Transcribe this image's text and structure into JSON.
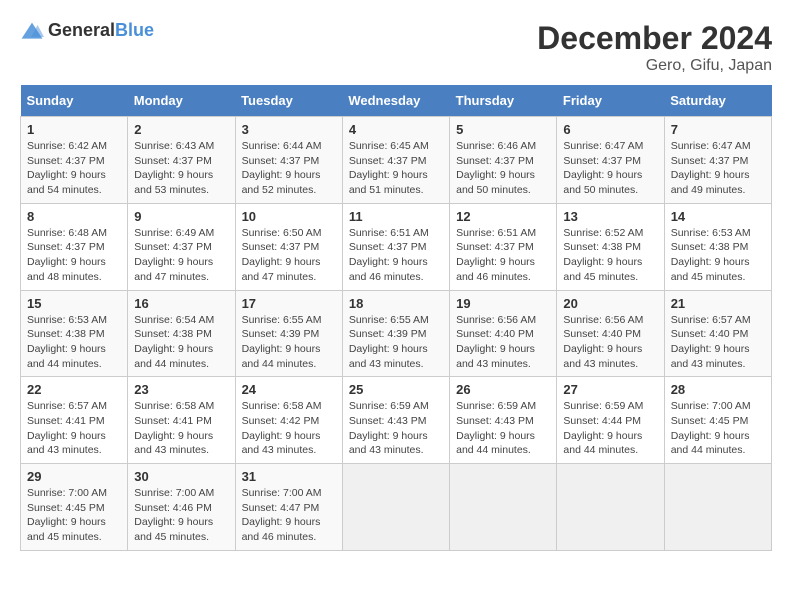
{
  "header": {
    "logo_general": "General",
    "logo_blue": "Blue",
    "title": "December 2024",
    "subtitle": "Gero, Gifu, Japan"
  },
  "days_of_week": [
    "Sunday",
    "Monday",
    "Tuesday",
    "Wednesday",
    "Thursday",
    "Friday",
    "Saturday"
  ],
  "weeks": [
    [
      {
        "day": "1",
        "sunrise": "6:42 AM",
        "sunset": "4:37 PM",
        "daylight": "9 hours and 54 minutes."
      },
      {
        "day": "2",
        "sunrise": "6:43 AM",
        "sunset": "4:37 PM",
        "daylight": "9 hours and 53 minutes."
      },
      {
        "day": "3",
        "sunrise": "6:44 AM",
        "sunset": "4:37 PM",
        "daylight": "9 hours and 52 minutes."
      },
      {
        "day": "4",
        "sunrise": "6:45 AM",
        "sunset": "4:37 PM",
        "daylight": "9 hours and 51 minutes."
      },
      {
        "day": "5",
        "sunrise": "6:46 AM",
        "sunset": "4:37 PM",
        "daylight": "9 hours and 50 minutes."
      },
      {
        "day": "6",
        "sunrise": "6:47 AM",
        "sunset": "4:37 PM",
        "daylight": "9 hours and 50 minutes."
      },
      {
        "day": "7",
        "sunrise": "6:47 AM",
        "sunset": "4:37 PM",
        "daylight": "9 hours and 49 minutes."
      }
    ],
    [
      {
        "day": "8",
        "sunrise": "6:48 AM",
        "sunset": "4:37 PM",
        "daylight": "9 hours and 48 minutes."
      },
      {
        "day": "9",
        "sunrise": "6:49 AM",
        "sunset": "4:37 PM",
        "daylight": "9 hours and 47 minutes."
      },
      {
        "day": "10",
        "sunrise": "6:50 AM",
        "sunset": "4:37 PM",
        "daylight": "9 hours and 47 minutes."
      },
      {
        "day": "11",
        "sunrise": "6:51 AM",
        "sunset": "4:37 PM",
        "daylight": "9 hours and 46 minutes."
      },
      {
        "day": "12",
        "sunrise": "6:51 AM",
        "sunset": "4:37 PM",
        "daylight": "9 hours and 46 minutes."
      },
      {
        "day": "13",
        "sunrise": "6:52 AM",
        "sunset": "4:38 PM",
        "daylight": "9 hours and 45 minutes."
      },
      {
        "day": "14",
        "sunrise": "6:53 AM",
        "sunset": "4:38 PM",
        "daylight": "9 hours and 45 minutes."
      }
    ],
    [
      {
        "day": "15",
        "sunrise": "6:53 AM",
        "sunset": "4:38 PM",
        "daylight": "9 hours and 44 minutes."
      },
      {
        "day": "16",
        "sunrise": "6:54 AM",
        "sunset": "4:38 PM",
        "daylight": "9 hours and 44 minutes."
      },
      {
        "day": "17",
        "sunrise": "6:55 AM",
        "sunset": "4:39 PM",
        "daylight": "9 hours and 44 minutes."
      },
      {
        "day": "18",
        "sunrise": "6:55 AM",
        "sunset": "4:39 PM",
        "daylight": "9 hours and 43 minutes."
      },
      {
        "day": "19",
        "sunrise": "6:56 AM",
        "sunset": "4:40 PM",
        "daylight": "9 hours and 43 minutes."
      },
      {
        "day": "20",
        "sunrise": "6:56 AM",
        "sunset": "4:40 PM",
        "daylight": "9 hours and 43 minutes."
      },
      {
        "day": "21",
        "sunrise": "6:57 AM",
        "sunset": "4:40 PM",
        "daylight": "9 hours and 43 minutes."
      }
    ],
    [
      {
        "day": "22",
        "sunrise": "6:57 AM",
        "sunset": "4:41 PM",
        "daylight": "9 hours and 43 minutes."
      },
      {
        "day": "23",
        "sunrise": "6:58 AM",
        "sunset": "4:41 PM",
        "daylight": "9 hours and 43 minutes."
      },
      {
        "day": "24",
        "sunrise": "6:58 AM",
        "sunset": "4:42 PM",
        "daylight": "9 hours and 43 minutes."
      },
      {
        "day": "25",
        "sunrise": "6:59 AM",
        "sunset": "4:43 PM",
        "daylight": "9 hours and 43 minutes."
      },
      {
        "day": "26",
        "sunrise": "6:59 AM",
        "sunset": "4:43 PM",
        "daylight": "9 hours and 44 minutes."
      },
      {
        "day": "27",
        "sunrise": "6:59 AM",
        "sunset": "4:44 PM",
        "daylight": "9 hours and 44 minutes."
      },
      {
        "day": "28",
        "sunrise": "7:00 AM",
        "sunset": "4:45 PM",
        "daylight": "9 hours and 44 minutes."
      }
    ],
    [
      {
        "day": "29",
        "sunrise": "7:00 AM",
        "sunset": "4:45 PM",
        "daylight": "9 hours and 45 minutes."
      },
      {
        "day": "30",
        "sunrise": "7:00 AM",
        "sunset": "4:46 PM",
        "daylight": "9 hours and 45 minutes."
      },
      {
        "day": "31",
        "sunrise": "7:00 AM",
        "sunset": "4:47 PM",
        "daylight": "9 hours and 46 minutes."
      },
      null,
      null,
      null,
      null
    ]
  ],
  "labels": {
    "sunrise": "Sunrise:",
    "sunset": "Sunset:",
    "daylight": "Daylight:"
  }
}
